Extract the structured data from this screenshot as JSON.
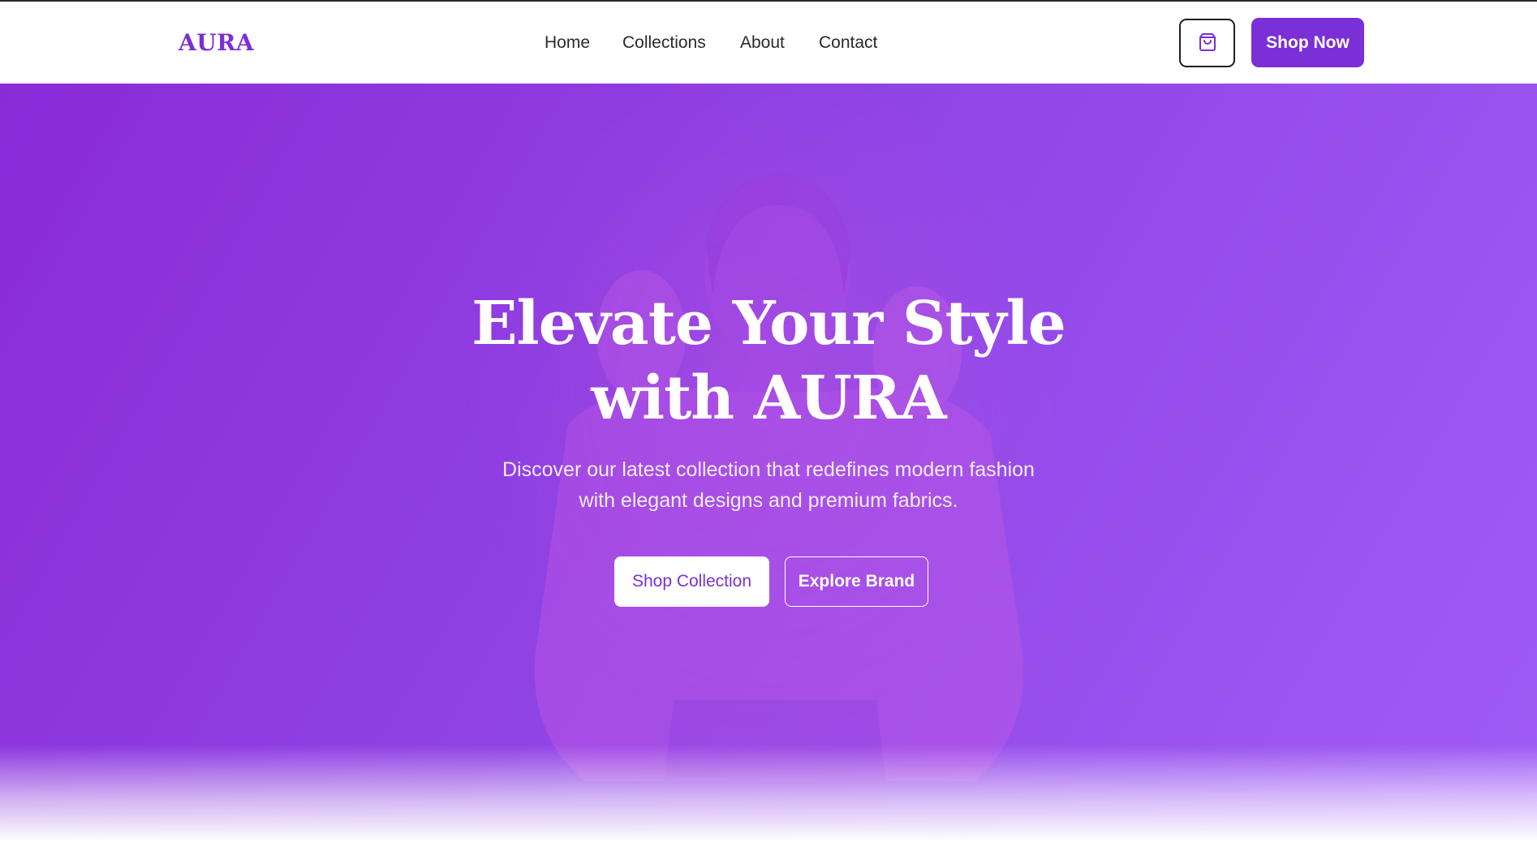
{
  "brand": {
    "logo_text": "AURA",
    "accent_color": "#7b2fd6"
  },
  "nav": {
    "links": [
      {
        "label": "Home"
      },
      {
        "label": "Collections"
      },
      {
        "label": "About"
      },
      {
        "label": "Contact"
      }
    ],
    "cart_icon": "shopping-bag-icon",
    "shop_now_label": "Shop Now"
  },
  "hero": {
    "title_line1": "Elevate Your Style",
    "title_line2": "with AURA",
    "subtitle_line1": "Discover our latest collection that redefines modern fashion",
    "subtitle_line2": "with elegant designs and premium fabrics.",
    "primary_cta": "Shop Collection",
    "secondary_cta": "Explore Brand",
    "background_start": "#8a2bd8",
    "background_end": "#a05cf6"
  }
}
